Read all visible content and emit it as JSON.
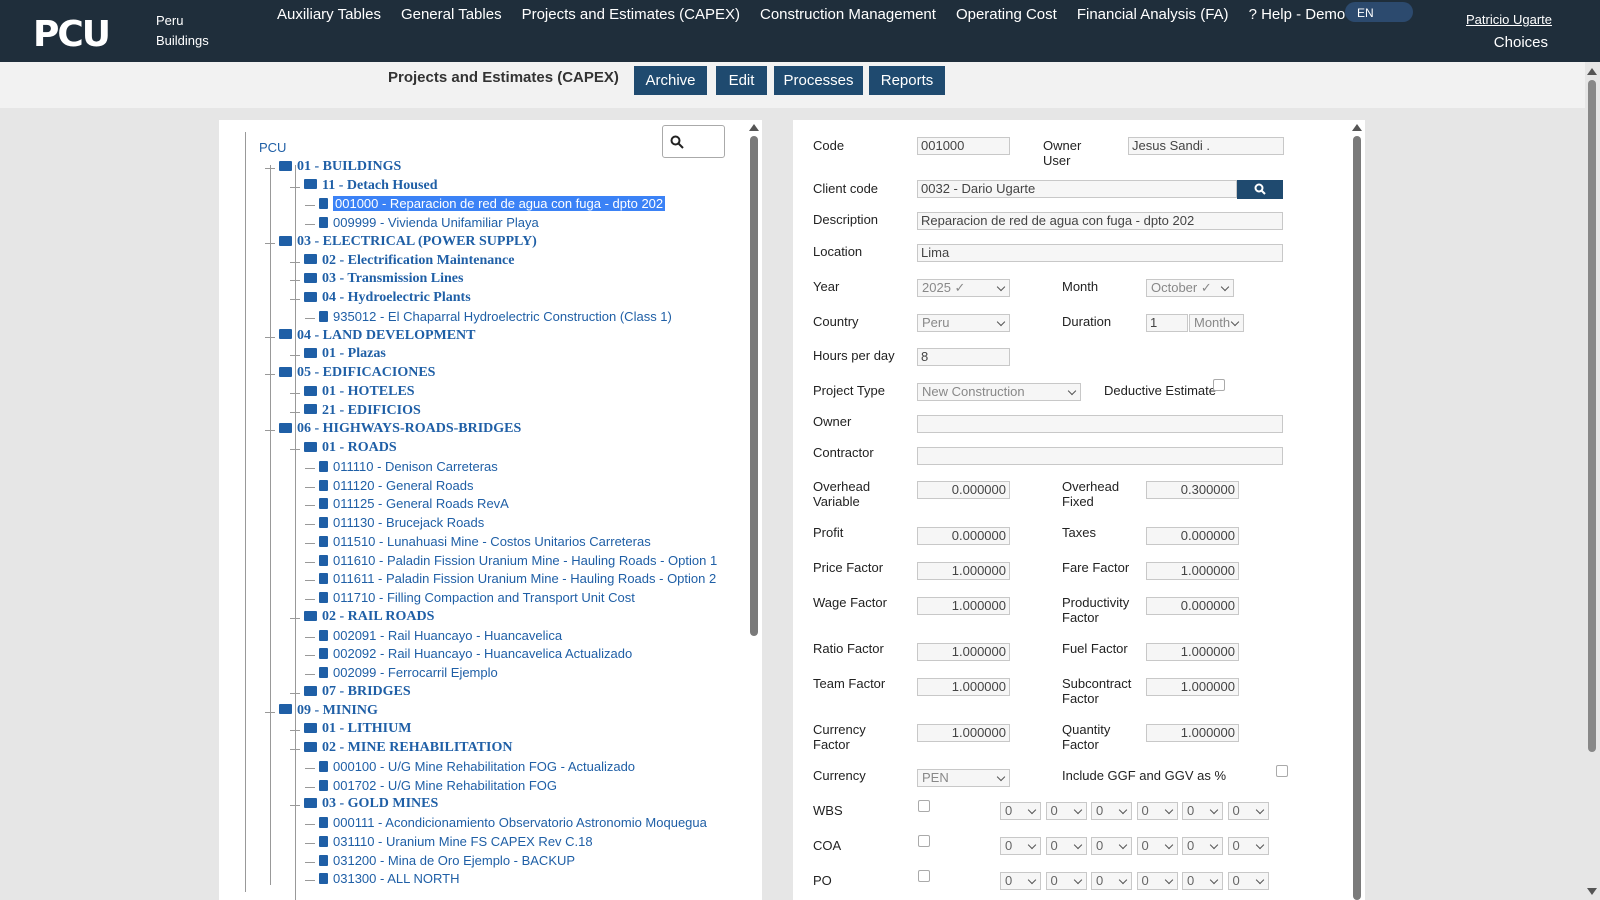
{
  "brand": {
    "logo": "PCU",
    "company_line1": "Peru",
    "company_line2": "Buildings"
  },
  "menu": [
    "Auxiliary Tables",
    "General Tables",
    "Projects and Estimates (CAPEX)",
    "Construction Management",
    "Operating Cost",
    "Financial Analysis (FA)",
    "? Help - Demo"
  ],
  "lang": "EN",
  "user": "Patricio Ugarte",
  "choices": "Choices",
  "toolbar": {
    "title": "Projects and Estimates (CAPEX)",
    "archive": "Archive",
    "edit": "Edit",
    "processes": "Processes",
    "reports": "Reports"
  },
  "tree": [
    {
      "label": "PCU",
      "type": "root",
      "level": 0
    },
    {
      "label": "01 - BUILDINGS",
      "type": "folder",
      "level": 1
    },
    {
      "label": "11 - Detach Housed",
      "type": "folder",
      "level": 2
    },
    {
      "label": "001000 - Reparacion de red de agua con fuga - dpto 202",
      "type": "file",
      "level": 3,
      "selected": true
    },
    {
      "label": "009999 - Vivienda Unifamiliar Playa",
      "type": "file",
      "level": 3
    },
    {
      "label": "03 - ELECTRICAL (POWER SUPPLY)",
      "type": "folder",
      "level": 1
    },
    {
      "label": "02 - Electrification Maintenance",
      "type": "folder",
      "level": 2
    },
    {
      "label": "03 - Transmission Lines",
      "type": "folder",
      "level": 2
    },
    {
      "label": "04 - Hydroelectric Plants",
      "type": "folder",
      "level": 2
    },
    {
      "label": "935012 - El Chaparral Hydroelectric Construction (Class 1)",
      "type": "file",
      "level": 3
    },
    {
      "label": "04 - LAND DEVELOPMENT",
      "type": "folder",
      "level": 1
    },
    {
      "label": "01 - Plazas",
      "type": "folder",
      "level": 2
    },
    {
      "label": "05 - EDIFICACIONES",
      "type": "folder",
      "level": 1
    },
    {
      "label": "01 - HOTELES",
      "type": "folder",
      "level": 2
    },
    {
      "label": "21 - EDIFICIOS",
      "type": "folder",
      "level": 2
    },
    {
      "label": "06 - HIGHWAYS-ROADS-BRIDGES",
      "type": "folder",
      "level": 1
    },
    {
      "label": "01 - ROADS",
      "type": "folder",
      "level": 2
    },
    {
      "label": "011110 - Denison Carreteras",
      "type": "file",
      "level": 3
    },
    {
      "label": "011120 - General Roads",
      "type": "file",
      "level": 3
    },
    {
      "label": "011125 - General Roads RevA",
      "type": "file",
      "level": 3
    },
    {
      "label": "011130 - Brucejack Roads",
      "type": "file",
      "level": 3
    },
    {
      "label": "011510 - Lunahuasi Mine - Costos Unitarios Carreteras",
      "type": "file",
      "level": 3
    },
    {
      "label": "011610 - Paladin Fission Uranium Mine - Hauling Roads - Option 1",
      "type": "file",
      "level": 3
    },
    {
      "label": "011611 - Paladin Fission Uranium Mine - Hauling Roads - Option 2",
      "type": "file",
      "level": 3
    },
    {
      "label": "011710 - Filling Compaction and Transport Unit Cost",
      "type": "file",
      "level": 3
    },
    {
      "label": "02 - RAIL ROADS",
      "type": "folder",
      "level": 2
    },
    {
      "label": "002091 - Rail Huancayo - Huancavelica",
      "type": "file",
      "level": 3
    },
    {
      "label": "002092 - Rail Huancayo - Huancavelica Actualizado",
      "type": "file",
      "level": 3
    },
    {
      "label": "002099 - Ferrocarril Ejemplo",
      "type": "file",
      "level": 3
    },
    {
      "label": "07 - BRIDGES",
      "type": "folder",
      "level": 2
    },
    {
      "label": "09 - MINING",
      "type": "folder",
      "level": 1
    },
    {
      "label": "01 - LITHIUM",
      "type": "folder",
      "level": 2
    },
    {
      "label": "02 - MINE REHABILITATION",
      "type": "folder",
      "level": 2
    },
    {
      "label": "000100 - U/G Mine Rehabilitation FOG - Actualizado",
      "type": "file",
      "level": 3
    },
    {
      "label": "001702 - U/G Mine Rehabilitation FOG",
      "type": "file",
      "level": 3
    },
    {
      "label": "03 - GOLD MINES",
      "type": "folder",
      "level": 2
    },
    {
      "label": "000111 - Acondicionamiento Observatorio Astronomio Moquegua",
      "type": "file",
      "level": 3
    },
    {
      "label": "031110 - Uranium Mine FS CAPEX Rev C.18",
      "type": "file",
      "level": 3
    },
    {
      "label": "031200 - Mina de Oro Ejemplo - BACKUP",
      "type": "file",
      "level": 3
    },
    {
      "label": "031300 - ALL NORTH",
      "type": "file",
      "level": 3
    }
  ],
  "form": {
    "code_label": "Code",
    "code": "001000",
    "owner_user_label1": "Owner",
    "owner_user_label2": "User",
    "owner_user": "Jesus Sandi .",
    "client_code_label": "Client code",
    "client_code": "0032 - Dario Ugarte",
    "description_label": "Description",
    "description": "Reparacion de red de agua con fuga - dpto 202",
    "location_label": "Location",
    "location": "Lima",
    "year_label": "Year",
    "year": "2025 ✓",
    "month_label": "Month",
    "month": "October ✓",
    "country_label": "Country",
    "country": "Peru",
    "duration_label": "Duration",
    "duration": "1",
    "duration_unit": "Month",
    "hours_label": "Hours per day",
    "hours": "8",
    "project_type_label": "Project Type",
    "project_type": "New Construction",
    "deductive_label": "Deductive Estimate",
    "owner_label": "Owner",
    "owner": "",
    "contractor_label": "Contractor",
    "contractor": "",
    "overhead_var_label1": "Overhead",
    "overhead_var_label2": "Variable",
    "overhead_var": "0.000000",
    "overhead_fixed_label1": "Overhead",
    "overhead_fixed_label2": "Fixed",
    "overhead_fixed": "0.300000",
    "profit_label": "Profit",
    "profit": "0.000000",
    "taxes_label": "Taxes",
    "taxes": "0.000000",
    "price_factor_label": "Price Factor",
    "price_factor": "1.000000",
    "fare_factor_label": "Fare Factor",
    "fare_factor": "1.000000",
    "wage_factor_label": "Wage Factor",
    "wage_factor": "1.000000",
    "productivity_label1": "Productivity",
    "productivity_label2": "Factor",
    "productivity": "0.000000",
    "ratio_factor_label": "Ratio Factor",
    "ratio_factor": "1.000000",
    "fuel_factor_label": "Fuel Factor",
    "fuel_factor": "1.000000",
    "team_factor_label": "Team Factor",
    "team_factor": "1.000000",
    "subcontract_label1": "Subcontract",
    "subcontract_label2": "Factor",
    "subcontract": "1.000000",
    "currency_factor_label1": "Currency",
    "currency_factor_label2": "Factor",
    "currency_factor": "1.000000",
    "quantity_factor_label1": "Quantity",
    "quantity_factor_label2": "Factor",
    "quantity_factor": "1.000000",
    "currency_label": "Currency",
    "currency": "PEN",
    "include_ggf_label": "Include GGF and GGV as %",
    "wbs_label": "WBS",
    "coa_label": "COA",
    "po_label": "PO",
    "seg": [
      "0",
      "0",
      "0",
      "0",
      "0",
      "0"
    ]
  }
}
